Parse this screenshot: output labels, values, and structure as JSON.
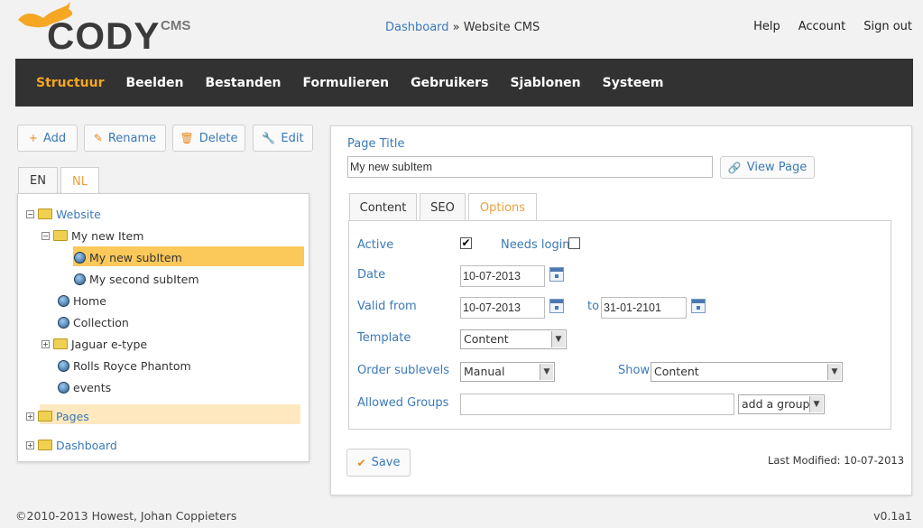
{
  "logo": {
    "name": "CODY",
    "suffix": "CMS"
  },
  "breadcrumb": {
    "link": "Dashboard",
    "sep": " » ",
    "current": "Website CMS"
  },
  "toplinks": [
    "Help",
    "Account",
    "Sign out"
  ],
  "nav": [
    "Structuur",
    "Beelden",
    "Bestanden",
    "Formulieren",
    "Gebruikers",
    "Sjablonen",
    "Systeem"
  ],
  "toolbar": {
    "add": "Add",
    "rename": "Rename",
    "delete": "Delete",
    "edit": "Edit"
  },
  "lang_tabs": [
    "EN",
    "NL"
  ],
  "tree": {
    "website": "Website",
    "my_new_item": "My new Item",
    "my_new_subitem": "My new subItem",
    "my_second_subitem": "My second subItem",
    "home": "Home",
    "collection": "Collection",
    "jaguar": "Jaguar e-type",
    "rolls": "Rolls Royce Phantom",
    "events": "events",
    "pages": "Pages",
    "dashboard": "Dashboard"
  },
  "form": {
    "page_title_label": "Page Title",
    "page_title_value": "My new subItem",
    "view_page": "View Page",
    "tabs": [
      "Content",
      "SEO",
      "Options"
    ],
    "active_label": "Active",
    "needs_login_label": "Needs login",
    "date_label": "Date",
    "date_value": "10-07-2013",
    "valid_from_label": "Valid from",
    "valid_from_value": "10-07-2013",
    "to_label": "to",
    "to_value": "31-01-2101",
    "template_label": "Template",
    "template_value": "Content",
    "order_label": "Order sublevels",
    "order_value": "Manual",
    "show_label": "Show",
    "show_value": "Content",
    "groups_label": "Allowed Groups",
    "groups_value": "",
    "add_group": "add a group",
    "save": "Save",
    "last_modified": "Last Modified: 10-07-2013"
  },
  "footer": {
    "copyright": "©2010-2013 Howest, Johan Coppieters",
    "version": "v0.1a1"
  },
  "colors": {
    "accent": "#f5a623",
    "link": "#3a7ab8",
    "nav_bg": "#323232",
    "highlight": "#fbc85a"
  }
}
